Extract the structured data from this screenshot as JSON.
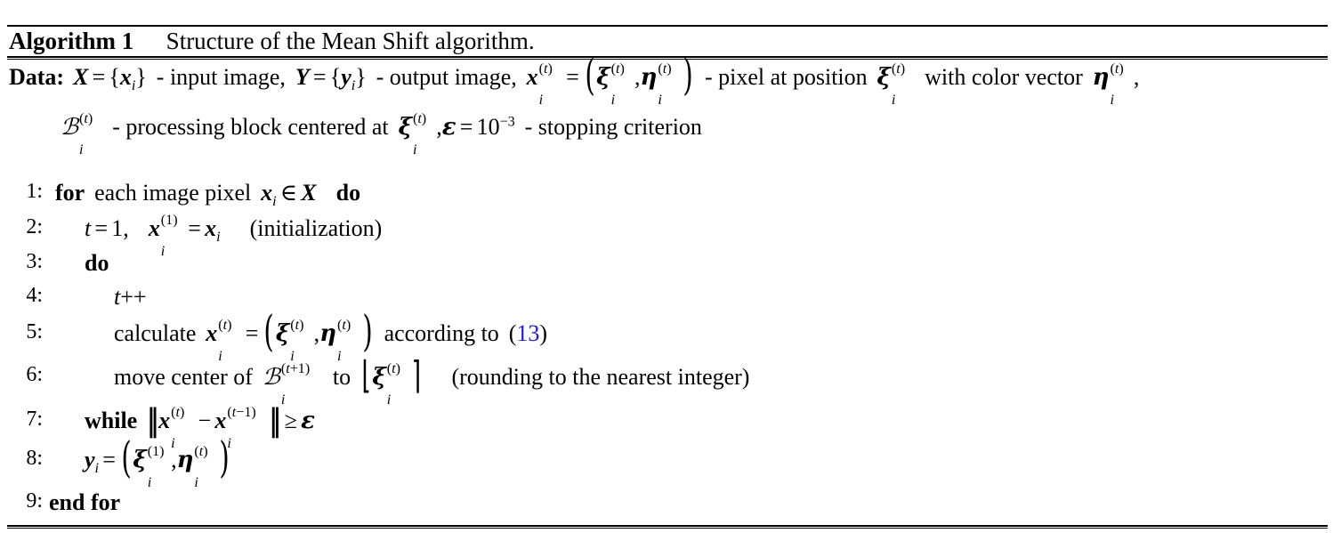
{
  "document": {
    "type": "algorithm-pseudocode-float",
    "caption_label": "Algorithm 1",
    "caption_text": "Structure of the Mean Shift algorithm.",
    "keywords": {
      "data": "Data:",
      "for": "for",
      "do": "do",
      "while": "while",
      "end_for": "end for"
    },
    "reference_color": "#1a1ae0"
  },
  "data_block": {
    "label": "Data:",
    "line1_plain": "X = {x_i} - input image, Y = {y_i} - output image, x_i^(t) = (ξ_i^(t), η_i^(t)) - pixel at position ξ_i^(t) with color vector η_i^(t),",
    "line2_plain": "B_i^(t) - processing block centered at ξ_i^(t), ε = 10^-3 - stopping criterion",
    "fragments": {
      "input_image_desc": "- input image,",
      "output_image_desc": "- output image,",
      "pixel_desc": "- pixel at position",
      "color_vector_desc": "with color vector",
      "block_desc": "- processing block centered at",
      "epsilon_value": "10",
      "epsilon_exponent": "−3",
      "stopping_desc": "- stopping criterion"
    }
  },
  "lines": [
    {
      "number": "1:",
      "indent": 0,
      "plain": "for each image pixel x_i ∈ X  do",
      "keyword_start": "for",
      "text": "each image pixel",
      "keyword_end": "do"
    },
    {
      "number": "2:",
      "indent": 1,
      "plain": "t = 1,  x_i^(1) = x_i   (initialization)",
      "comment": "(initialization)"
    },
    {
      "number": "3:",
      "indent": 1,
      "plain": "do",
      "keyword": "do"
    },
    {
      "number": "4:",
      "indent": 2,
      "plain": "t++"
    },
    {
      "number": "5:",
      "indent": 2,
      "plain": "calculate x_i^(t) = (ξ_i^(t), η_i^(t)) according to (13)",
      "text_start": "calculate",
      "text_end": "according to",
      "reference": "13"
    },
    {
      "number": "6:",
      "indent": 2,
      "plain": "move center of B_i^(t+1) to ⌊ξ_i^(t)⌉   (rounding to the nearest integer)",
      "text_start": "move center of",
      "text_mid": "to",
      "comment": "(rounding to the nearest integer)"
    },
    {
      "number": "7:",
      "indent": 1,
      "plain": "while ‖x_i^(t) − x_i^(t−1)‖ ≥ ε",
      "keyword": "while"
    },
    {
      "number": "8:",
      "indent": 1,
      "plain": "y_i = (ξ_i^(1), η_i^(t))"
    },
    {
      "number": "9:",
      "indent": 0,
      "plain": "end for",
      "keyword": "end for"
    }
  ],
  "symbols": {
    "X": "X",
    "Y": "Y",
    "x": "x",
    "y": "y",
    "t": "t",
    "i": "i",
    "one": "1",
    "xi": "ξ",
    "eta": "η",
    "epsilon": "ε",
    "B": "ℬ",
    "in": "∈",
    "eq": "=",
    "minus": "−",
    "geq": "≥",
    "plus": "+",
    "plusplus": "++",
    "comma": ",",
    "dash": "-",
    "lbrace": "{",
    "rbrace": "}",
    "lparen": "(",
    "rparen": ")",
    "lfloor": "⌊",
    "rceil": "⌉",
    "dblbar": "‖"
  }
}
